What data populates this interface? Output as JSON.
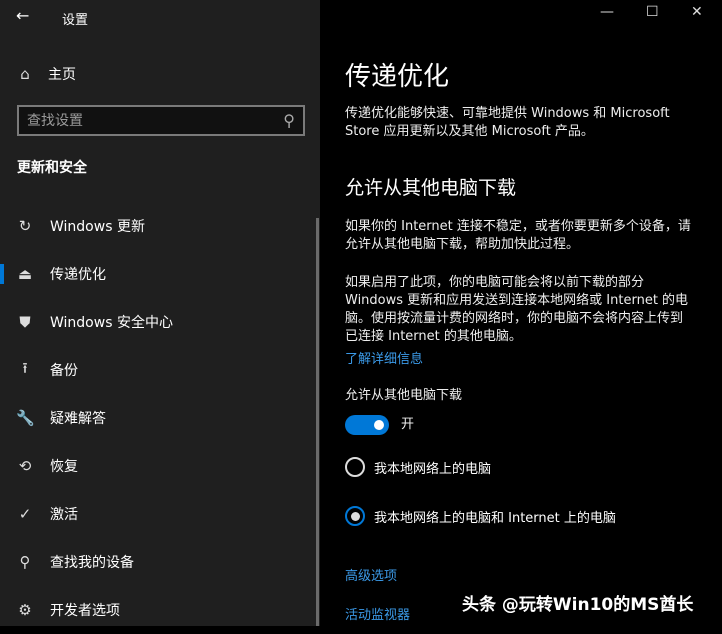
{
  "window": {
    "title": "设置"
  },
  "sidebar": {
    "home": "主页",
    "search_placeholder": "查找设置",
    "section": "更新和安全",
    "items": [
      {
        "label": "Windows 更新",
        "icon": "↻"
      },
      {
        "label": "传递优化",
        "icon": "⏏"
      },
      {
        "label": "Windows 安全中心",
        "icon": "⛊"
      },
      {
        "label": "备份",
        "icon": "⭱"
      },
      {
        "label": "疑难解答",
        "icon": "🔧"
      },
      {
        "label": "恢复",
        "icon": "⟲"
      },
      {
        "label": "激活",
        "icon": "✓"
      },
      {
        "label": "查找我的设备",
        "icon": "⚲"
      },
      {
        "label": "开发者选项",
        "icon": "⚙"
      }
    ]
  },
  "main": {
    "title": "传递优化",
    "desc1": "传递优化能够快速、可靠地提供 Windows 和 Microsoft Store 应用更新以及其他 Microsoft 产品。",
    "heading": "允许从其他电脑下载",
    "desc2": "如果你的 Internet 连接不稳定，或者你要更新多个设备，请允许从其他电脑下载，帮助加快此过程。",
    "desc3": "如果启用了此项，你的电脑可能会将以前下载的部分 Windows 更新和应用发送到连接本地网络或 Internet 的电脑。使用按流量计费的网络时，你的电脑不会将内容上传到已连接 Internet 的其他电脑。",
    "learn_more": "了解详细信息",
    "toggle_label": "允许从其他电脑下载",
    "toggle_state": "开",
    "radio1": "我本地网络上的电脑",
    "radio2": "我本地网络上的电脑和 Internet 上的电脑",
    "advanced": "高级选项",
    "monitor": "活动监视器"
  },
  "watermark": "头条 @玩转Win10的MS酋长"
}
